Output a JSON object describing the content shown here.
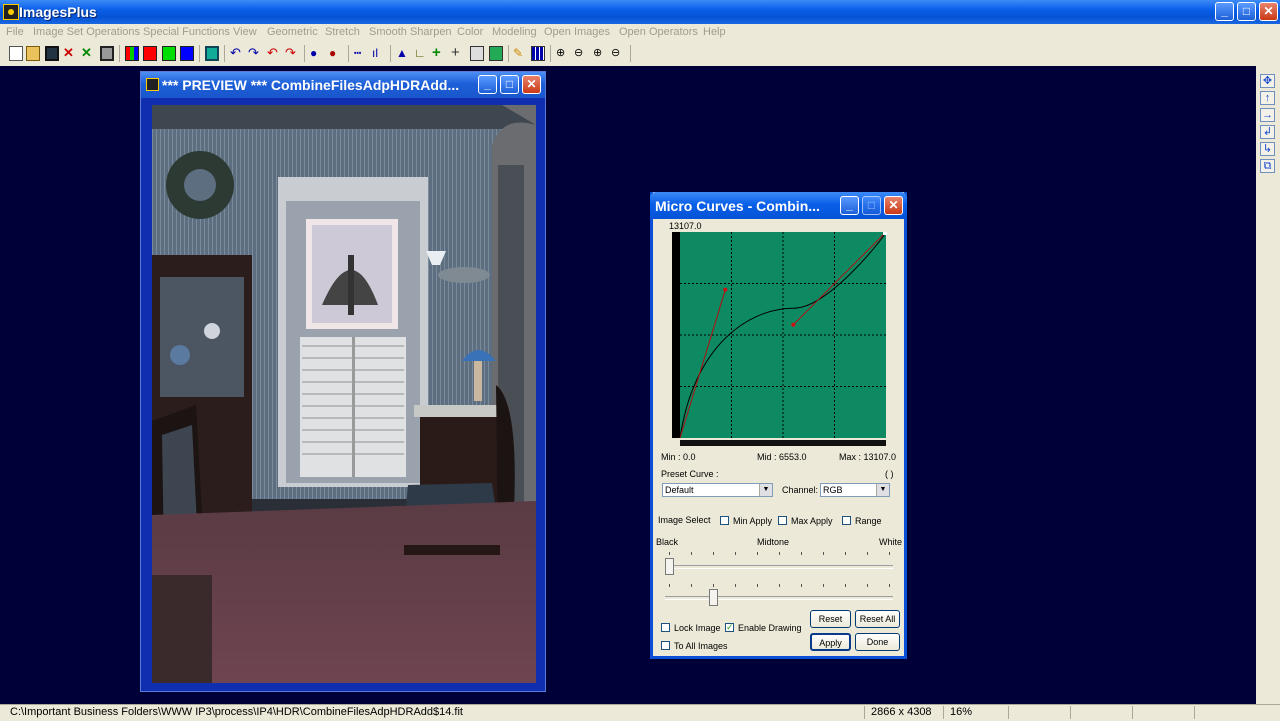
{
  "app": {
    "title": "ImagesPlus"
  },
  "menu": [
    "File",
    "Image Set Operations",
    "Special Functions",
    "View",
    "Geometric",
    "Stretch",
    "Smooth Sharpen",
    "Color",
    "Modeling",
    "Open Images",
    "Open Operators",
    "Help"
  ],
  "toolbar_icons": [
    "new-icon",
    "open-icon",
    "save-icon",
    "close-image-icon",
    "close-all-icon",
    "print-icon",
    "rgb-icon",
    "red-channel-icon",
    "green-channel-icon",
    "blue-channel-icon",
    "cmy-icon",
    "undo-icon",
    "redo-icon",
    "undo-all-icon",
    "redo-all-icon",
    "point-icon",
    "point-red-icon",
    "line-profile-icon",
    "histogram-icon",
    "triangle-icon",
    "crop-icon",
    "crosshair-green-icon",
    "crosshair-icon",
    "grid-icon",
    "paint-icon",
    "pencil-icon",
    "mosaic-icon",
    "zoom-in-icon",
    "zoom-out-icon",
    "zoom-fit-icon",
    "zoom-reset-icon"
  ],
  "colors": {
    "workspace": "#000039",
    "curve_bg": "#0e8a62",
    "window_blue": "#0a5fe8"
  },
  "preview": {
    "title": "*** PREVIEW *** CombineFilesAdpHDRAdd..."
  },
  "curves": {
    "title": "Micro Curves - Combin...",
    "max_label": "13107.0",
    "min_label": "Min :  0.0",
    "mid_label": "Mid :  6553.0",
    "max_readout": "Max :  13107.0",
    "preset_label": "Preset Curve :",
    "paren": "( )",
    "preset_value": "Default",
    "channel_label": "Channel:",
    "channel_value": "RGB",
    "image_select_label": "Image Select",
    "min_apply": "Min Apply",
    "max_apply": "Max Apply",
    "range": "Range",
    "black": "Black",
    "midtone": "Midtone",
    "white": "White",
    "lock_image": "Lock Image",
    "enable_drawing": "Enable Drawing",
    "enable_drawing_checked": true,
    "to_all_images": "To All Images",
    "reset": "Reset",
    "reset_all": "Reset All",
    "apply": "Apply",
    "done": "Done",
    "black_slider": 0.0,
    "midtone_slider": 0.2,
    "curve_points": [
      {
        "x": 0,
        "y": 0
      },
      {
        "x": 1,
        "y": 1
      }
    ],
    "control_points": [
      {
        "x": 0.22,
        "y": 0.72
      },
      {
        "x": 0.55,
        "y": 0.55
      }
    ]
  },
  "status": {
    "path": "C:\\Important Business Folders\\WWW IP3\\process\\IP4\\HDR\\CombineFilesAdpHDRAdd$14.fit",
    "dimensions": "2866 x 4308",
    "zoom": "16%"
  }
}
